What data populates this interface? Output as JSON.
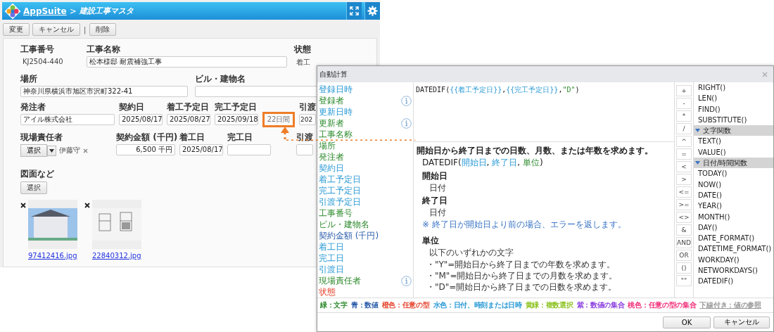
{
  "header": {
    "app_name": "AppSuite",
    "separator": ">",
    "page_title": "建設工事マスタ"
  },
  "toolbar": [
    {
      "kind": "button",
      "label": "変更"
    },
    {
      "kind": "button",
      "label": "キャンセル"
    },
    {
      "kind": "separator",
      "label": "|"
    },
    {
      "kind": "button",
      "label": "削除"
    }
  ],
  "form_rows": [
    [
      {
        "kind": "text",
        "label": "工事番号",
        "value": "KJ2504-440"
      },
      {
        "kind": "input",
        "label": "工事名称",
        "value": "松本様邸 耐震補強工事"
      },
      {
        "kind": "text",
        "label": "状態",
        "value": "着工"
      }
    ],
    [
      {
        "kind": "input",
        "label": "場所",
        "value": "神奈川県横浜市旭区市沢町322-41"
      },
      {
        "kind": "input",
        "label": "ビル・建物名"
      }
    ],
    [
      {
        "kind": "input",
        "label": "発注者",
        "value": "アイル株式会社"
      },
      {
        "kind": "input",
        "label": "契約日",
        "value": "2025/08/17"
      },
      {
        "kind": "input",
        "label": "着工予定日",
        "value": "2025/08/27"
      },
      {
        "kind": "input",
        "label": "完工予定日",
        "value": "2025/09/18"
      },
      {
        "kind": "computed",
        "value": "22日間",
        "highlighted": true
      },
      {
        "kind": "input",
        "label": "引渡",
        "value": "202"
      }
    ],
    [
      {
        "kind": "select",
        "label": "現場責任者",
        "button": "選択",
        "person": "伊藤守"
      },
      {
        "kind": "amount",
        "label": "契約金額 (千円)",
        "value": "6,500",
        "unit": "千円"
      },
      {
        "kind": "input",
        "label": "着工日",
        "value": "2025/08/17"
      },
      {
        "kind": "input",
        "label": "完工日"
      },
      {
        "kind": "input",
        "label": "引渡"
      }
    ]
  ],
  "attachments": {
    "label": "図面など",
    "button": "選択",
    "files": [
      {
        "name": "97412416.jpg",
        "kind": "photo"
      },
      {
        "name": "22840312.jpg",
        "kind": "plan"
      }
    ]
  },
  "dialog": {
    "title": "自動計算",
    "fields": [
      {
        "label": "登録日時",
        "kind": "date",
        "info": false
      },
      {
        "label": "登録者",
        "kind": "text",
        "info": true
      },
      {
        "label": "更新日時",
        "kind": "date",
        "info": false
      },
      {
        "label": "更新者",
        "kind": "text",
        "info": true
      },
      {
        "label": "工事名称",
        "kind": "text",
        "info": false
      },
      {
        "label": "場所",
        "kind": "text",
        "info": false
      },
      {
        "label": "発注者",
        "kind": "text",
        "info": false
      },
      {
        "label": "契約日",
        "kind": "date",
        "info": false
      },
      {
        "label": "着工予定日",
        "kind": "date",
        "info": false
      },
      {
        "label": "完工予定日",
        "kind": "date",
        "info": false
      },
      {
        "label": "引渡予定日",
        "kind": "date",
        "info": false
      },
      {
        "label": "工事番号",
        "kind": "text",
        "info": false
      },
      {
        "label": "ビル・建物名",
        "kind": "text",
        "info": false
      },
      {
        "label": "契約金額 (千円)",
        "kind": "number",
        "info": false
      },
      {
        "label": "着工日",
        "kind": "date",
        "info": false
      },
      {
        "label": "完工日",
        "kind": "date",
        "info": false
      },
      {
        "label": "引渡日",
        "kind": "date",
        "info": false
      },
      {
        "label": "現場責任者",
        "kind": "text",
        "info": true
      },
      {
        "label": "状態",
        "kind": "any",
        "info": false
      }
    ],
    "formula": [
      {
        "text": "DATEDIF(",
        "kind": "plain"
      },
      {
        "text": "{{着工予定日}}",
        "kind": "date"
      },
      {
        "text": ",",
        "kind": "plain"
      },
      {
        "text": "{{完工予定日}}",
        "kind": "date"
      },
      {
        "text": ",",
        "kind": "plain"
      },
      {
        "text": "\"D\"",
        "kind": "text"
      },
      {
        "text": ")",
        "kind": "plain"
      }
    ],
    "help": {
      "summary": "開始日から終了日までの日数、月数、または年数を求めます。",
      "syntax": [
        {
          "text": "DATEDIF(",
          "kind": "plain"
        },
        {
          "text": "開始日",
          "kind": "date"
        },
        {
          "text": ", ",
          "kind": "plain"
        },
        {
          "text": "終了日",
          "kind": "date"
        },
        {
          "text": ", ",
          "kind": "plain"
        },
        {
          "text": "単位",
          "kind": "text"
        },
        {
          "text": ")",
          "kind": "plain"
        }
      ],
      "sections": [
        {
          "title": "開始日",
          "lines": [
            {
              "kind": "plain",
              "text": "日付"
            }
          ]
        },
        {
          "title": "終了日",
          "lines": [
            {
              "kind": "plain",
              "text": "日付"
            },
            {
              "kind": "note",
              "text": "※ 終了日が開始日より前の場合、エラーを返します。"
            }
          ]
        },
        {
          "title": "単位",
          "lines": [
            {
              "kind": "plain",
              "text": "以下のいずれかの文字"
            },
            {
              "kind": "bullet",
              "text": "・\"Y\"=開始日から終了日までの年数を求めます。"
            },
            {
              "kind": "bullet",
              "text": "・\"M\"=開始日から終了日までの月数を求めます。"
            },
            {
              "kind": "bullet",
              "text": "・\"D\"=開始日から終了日までの日数を求めます。"
            }
          ]
        }
      ]
    },
    "operators": [
      "+",
      "-",
      "*",
      "/",
      "^",
      "=",
      "<",
      ">",
      "<=",
      ">=",
      "<>",
      "&",
      "AND",
      "OR",
      "()",
      "\"\""
    ],
    "functions": [
      {
        "kind": "function",
        "label": "RIGHT()"
      },
      {
        "kind": "function",
        "label": "LEN()"
      },
      {
        "kind": "function",
        "label": "FIND()"
      },
      {
        "kind": "function",
        "label": "SUBSTITUTE()"
      },
      {
        "kind": "group",
        "label": "文字関数",
        "expanded": true
      },
      {
        "kind": "function",
        "label": "TEXT()"
      },
      {
        "kind": "function",
        "label": "VALUE()"
      },
      {
        "kind": "group",
        "label": "日付/時間関数",
        "expanded": true
      },
      {
        "kind": "function",
        "label": "TODAY()"
      },
      {
        "kind": "function",
        "label": "NOW()"
      },
      {
        "kind": "function",
        "label": "DATE()"
      },
      {
        "kind": "function",
        "label": "YEAR()"
      },
      {
        "kind": "function",
        "label": "MONTH()"
      },
      {
        "kind": "function",
        "label": "DAY()"
      },
      {
        "kind": "function",
        "label": "DATE_FORMAT()"
      },
      {
        "kind": "function",
        "label": "DATETIME_FORMAT()"
      },
      {
        "kind": "function",
        "label": "WORKDAY()"
      },
      {
        "kind": "function",
        "label": "NETWORKDAYS()"
      },
      {
        "kind": "function",
        "label": "DATEDIF()"
      }
    ],
    "legend": [
      {
        "text": "緑：文字",
        "color": "#2e8b2e",
        "kind": "plain"
      },
      {
        "text": "青：数値",
        "color": "#2a5caa",
        "kind": "plain"
      },
      {
        "text": "橙色：任意の型",
        "color": "#e5452f",
        "kind": "plain"
      },
      {
        "text": "水色：日付、時刻または日時",
        "color": "#2a9ad6",
        "kind": "plain"
      },
      {
        "text": "黄緑：複数選択",
        "color": "#8cc21e",
        "kind": "plain"
      },
      {
        "text": "紫：数値の集合",
        "color": "#8a3fe0",
        "kind": "plain"
      },
      {
        "text": "桃色：任意の型の集合",
        "color": "#f0307a",
        "kind": "plain"
      },
      {
        "text": "下線付き：値の参照",
        "color": "#9a9a9a",
        "kind": "underline"
      }
    ],
    "buttons": [
      "OK",
      "キャンセル"
    ]
  }
}
